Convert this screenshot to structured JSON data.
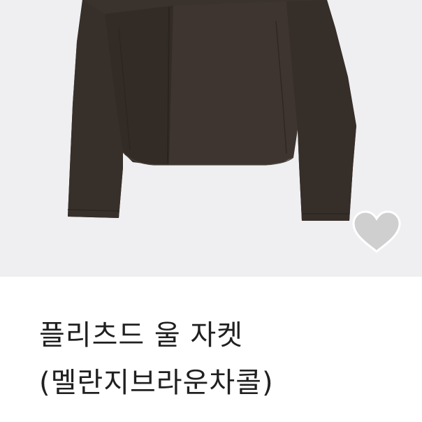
{
  "product": {
    "title": "플리츠드 울 자켓 (멜란지브라운차콜)",
    "image_alt": "",
    "like_icon": "heart-icon"
  },
  "colors": {
    "photo_bg": "#efeff1",
    "jacket": "#3a322c",
    "heart": "#cfcfcf",
    "title": "#202020"
  }
}
